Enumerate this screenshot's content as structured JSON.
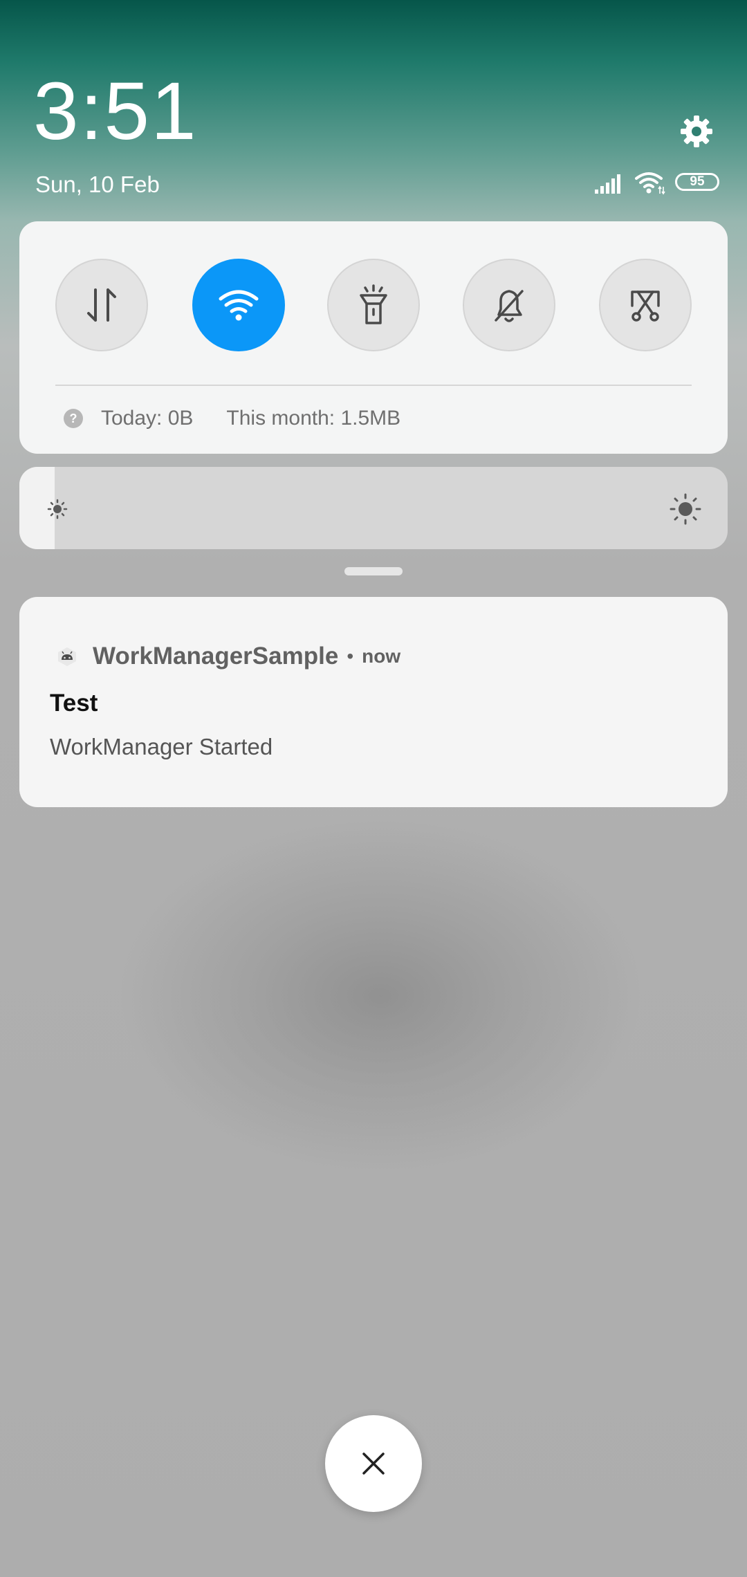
{
  "header": {
    "time": "3:51",
    "date": "Sun, 10 Feb",
    "battery_level": "95"
  },
  "quick_settings": {
    "toggles": [
      {
        "name": "mobile-data",
        "icon": "arrows-up-down-icon",
        "active": false
      },
      {
        "name": "wifi",
        "icon": "wifi-icon",
        "active": true
      },
      {
        "name": "flashlight",
        "icon": "flashlight-icon",
        "active": false
      },
      {
        "name": "silent",
        "icon": "bell-off-icon",
        "active": false
      },
      {
        "name": "screenshot",
        "icon": "scissors-icon",
        "active": false
      }
    ],
    "data_usage": {
      "today": "Today: 0B",
      "month": "This month: 1.5MB"
    },
    "accent_color": "#0b97f8"
  },
  "brightness": {
    "level": 0.05
  },
  "notification": {
    "app_name": "WorkManagerSample",
    "separator": "•",
    "time": "now",
    "title": "Test",
    "body": "WorkManager Started"
  }
}
